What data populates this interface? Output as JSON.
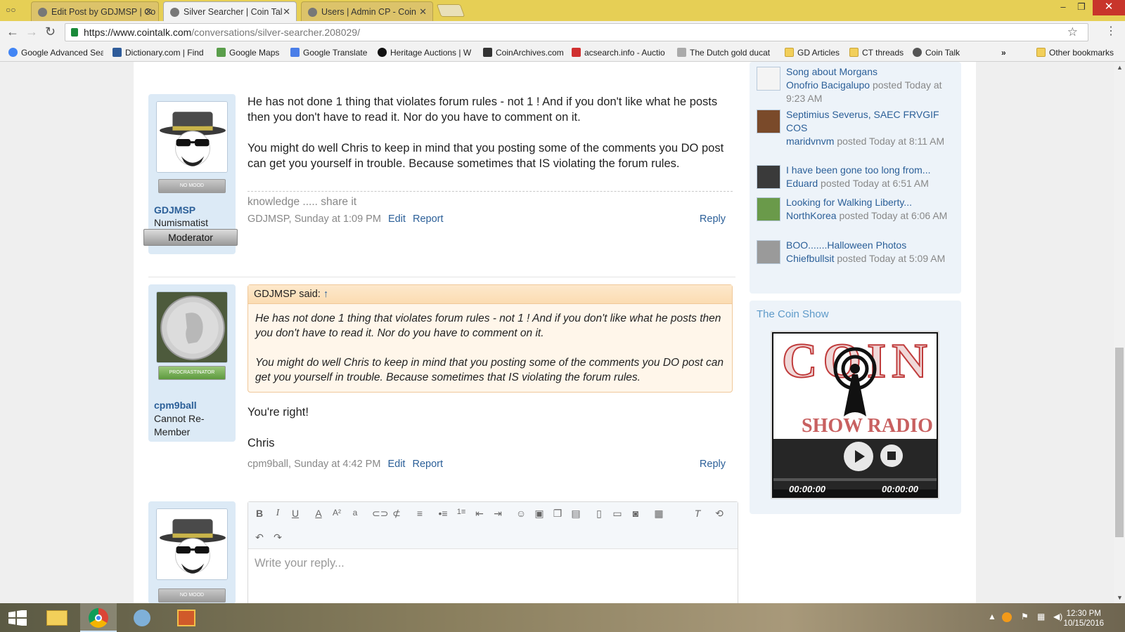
{
  "browser": {
    "tabs": [
      {
        "label": "Edit Post by GDJMSP | Co",
        "active": false
      },
      {
        "label": "Silver Searcher | Coin Tal",
        "active": true
      },
      {
        "label": "Users | Admin CP - Coin",
        "active": false
      }
    ],
    "url_host": "https://www.cointalk.com",
    "url_path": "/conversations/silver-searcher.208029/",
    "bookmarks": [
      {
        "label": "Google Advanced Sea",
        "icon": "google-icon"
      },
      {
        "label": "Dictionary.com | Find",
        "icon": "dictionary-icon"
      },
      {
        "label": "Google Maps",
        "icon": "maps-icon"
      },
      {
        "label": "Google Translate",
        "icon": "translate-icon"
      },
      {
        "label": "Heritage Auctions | W",
        "icon": "heritage-icon"
      },
      {
        "label": "CoinArchives.com",
        "icon": "coinarchives-icon"
      },
      {
        "label": "acsearch.info - Auctio",
        "icon": "acsearch-icon"
      },
      {
        "label": "The Dutch gold ducat",
        "icon": "ducat-icon"
      },
      {
        "label": "GD Articles",
        "icon": "folder-icon"
      },
      {
        "label": "CT threads",
        "icon": "folder-icon"
      },
      {
        "label": "Coin Talk",
        "icon": "cointalk-icon"
      }
    ],
    "more": "»",
    "other_bookmarks": "Other bookmarks"
  },
  "posts": [
    {
      "username": "GDJMSP",
      "user_title": "Numismatist",
      "ribbon": "Moderator",
      "mood": "NO MOOD",
      "paragraphs": [
        "He has not done 1 thing that violates forum rules - not 1 ! And if you don't like what he posts then you don't have to read it. Nor do you have to comment on it.",
        "You might do well Chris to keep in mind that you posting some of the comments you DO post can get you yourself in trouble. Because sometimes that IS violating the forum rules."
      ],
      "signature": "knowledge ..... share it",
      "meta": "GDJMSP, Sunday at 1:09 PM",
      "edit": "Edit",
      "report": "Report",
      "reply": "Reply"
    },
    {
      "username": "cpm9ball",
      "user_title": "Cannot Re-Member",
      "mood": "PROCRASTINATOR",
      "quote_author": "GDJMSP said:",
      "quote_arrow": "↑",
      "quote_paragraphs": [
        "He has not done 1 thing that violates forum rules - not 1 ! And if you don't like what he posts then you don't have to read it. Nor do you have to comment on it.",
        "You might do well Chris to keep in mind that you posting some of the comments you DO post can get you yourself in trouble. Because sometimes that IS violating the forum rules."
      ],
      "paragraphs": [
        "You're right!",
        "Chris"
      ],
      "meta": "cpm9ball, Sunday at 4:42 PM",
      "edit": "Edit",
      "report": "Report",
      "reply": "Reply"
    }
  ],
  "editor": {
    "placeholder": "Write your reply...",
    "mood": "NO MOOD"
  },
  "sidebar": {
    "items": [
      {
        "title": "Song about Morgans",
        "user": "Onofrio Bacigalupo",
        "posted": "posted Today at 9:23 AM"
      },
      {
        "title": "Septimius Severus, SAEC FRVGIF COS",
        "user": "maridvnvm",
        "posted": "posted Today at 8:11 AM"
      },
      {
        "title": "I have been gone too long from...",
        "user": "Eduard",
        "posted": "posted Today at 6:51 AM"
      },
      {
        "title": "Looking for Walking Liberty...",
        "user": "NorthKorea",
        "posted": "posted Today at 6:06 AM"
      },
      {
        "title": "BOO.......Halloween Photos",
        "user": "Chiefbullsit",
        "posted": "posted Today at 5:09 AM"
      }
    ],
    "coin_show_title": "The Coin Show",
    "player_time_left": "00:00:00",
    "player_time_right": "00:00:00",
    "player_art_text": "COIN",
    "player_art_text2": "SHOW RADIO"
  },
  "taskbar": {
    "time": "12:30 PM",
    "date": "10/15/2016"
  }
}
